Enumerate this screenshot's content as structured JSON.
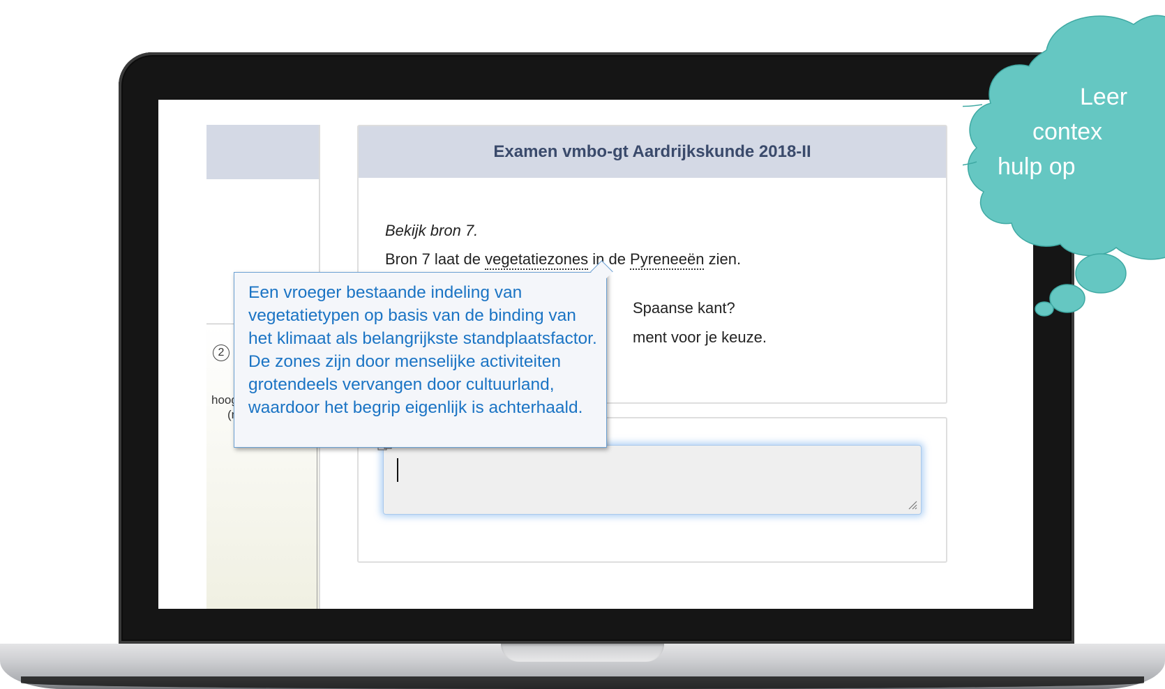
{
  "exam_title": "Examen vmbo-gt Aardrijkskunde 2018-II",
  "question": {
    "line1": "Bekijk bron 7.",
    "line2_pre": "Bron 7 laat de ",
    "line2_term1": "vegetatiezones",
    "line2_mid": " in de ",
    "line2_term2": "Pyreneeën",
    "line2_post": " zien.",
    "line3_visible": "Spaanse kant?",
    "line4_visible": "ment voor je keuze."
  },
  "figure": {
    "circled_number": "2",
    "axis_label": "hoog",
    "axis_unit": "(m)",
    "axis_arrow": "↑"
  },
  "tooltip": {
    "definition": "Een vroeger bestaande indeling van vegetatietypen op basis van de binding van het klimaat als belangrijkste standplaatsfactor. De zones zijn door menselijke activiteiten grotendeels vervangen door cultuurland, waardoor het begrip eigenlijk is achterhaald."
  },
  "answer": {
    "value": ""
  },
  "cloud": {
    "line1": "Leer",
    "line2": "contex",
    "line3": "hulp op"
  },
  "colors": {
    "header_bg": "#d4d9e5",
    "header_text": "#3a4a6b",
    "tooltip_text": "#1b74c4",
    "cloud_fill": "#65c7c2",
    "focus_glow": "#6eaaeb"
  },
  "icons": {
    "spellcheck": "spellcheck-icon",
    "resize": "resize-grip-icon"
  }
}
